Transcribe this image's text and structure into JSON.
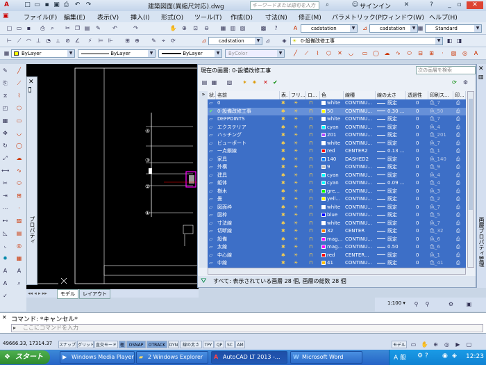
{
  "title_bar": {
    "title": "建築図面(異縮尺対応).dwg",
    "search_placeholder": "キーワードまたは語句を入力",
    "signin": "サインイン"
  },
  "menu": [
    "ファイル(F)",
    "編集(E)",
    "表示(V)",
    "挿入(I)",
    "形式(O)",
    "ツール(T)",
    "作成(D)",
    "寸法(N)",
    "修正(M)",
    "パラメトリック(P)",
    "ウィンドウ(W)",
    "ヘルプ(H)"
  ],
  "toolbars": {
    "annot_scale_1": "cadstation",
    "annot_scale_2": "cadstation",
    "annot_scale_3": "cadstation",
    "text_style": "Standard",
    "layer_combo": "0-設備改修工事",
    "props": {
      "color": "ByLayer",
      "linetype": "ByLayer",
      "lineweight": "ByLayer",
      "plotstyle": "ByColor"
    }
  },
  "layer_palette": {
    "current_layer": "現在の画層: 0-設備改修工事",
    "search_placeholder": "次の画層を検索",
    "columns": [
      "状.",
      "名前",
      "表.",
      "フリ...",
      "ロ...",
      "色",
      "線種",
      "線の太さ",
      "透過性",
      "印刷ス...",
      "印..."
    ],
    "rows": [
      {
        "name": "0",
        "color_name": "white",
        "color_hex": "#ffffff",
        "linetype": "CONTINU...",
        "lineweight": "既定",
        "transparency": "0",
        "plotstyle": "色_7",
        "current": false
      },
      {
        "name": "0-設備改修工事",
        "color_name": "50",
        "color_hex": "#ffff00",
        "linetype": "CONTINU...",
        "lineweight": "0.30 ...",
        "transparency": "0",
        "plotstyle": "色_50",
        "current": true
      },
      {
        "name": "DEFPOINTS",
        "color_name": "white",
        "color_hex": "#ffffff",
        "linetype": "CONTINU...",
        "lineweight": "既定",
        "transparency": "0",
        "plotstyle": "色_7",
        "current": false
      },
      {
        "name": "エクステリア",
        "color_name": "cyan",
        "color_hex": "#00ffff",
        "linetype": "CONTINU...",
        "lineweight": "既定",
        "transparency": "0",
        "plotstyle": "色_4",
        "current": false
      },
      {
        "name": "ハッチング",
        "color_name": "201",
        "color_hex": "#b24dff",
        "linetype": "CONTINU...",
        "lineweight": "既定",
        "transparency": "0",
        "plotstyle": "色_201",
        "current": false
      },
      {
        "name": "ビューポート",
        "color_name": "white",
        "color_hex": "#ffffff",
        "linetype": "CONTINU...",
        "lineweight": "既定",
        "transparency": "0",
        "plotstyle": "色_7",
        "current": false
      },
      {
        "name": "一点鎖線",
        "color_name": "red",
        "color_hex": "#ff0000",
        "linetype": "CENTER2",
        "lineweight": "0.13 ...",
        "transparency": "0",
        "plotstyle": "色_1",
        "current": false
      },
      {
        "name": "家具",
        "color_name": "140",
        "color_hex": "#007fff",
        "linetype": "DASHED2",
        "lineweight": "既定",
        "transparency": "0",
        "plotstyle": "色_140",
        "current": false
      },
      {
        "name": "外構",
        "color_name": "9",
        "color_hex": "#c0c0c0",
        "linetype": "CONTINU...",
        "lineweight": "既定",
        "transparency": "0",
        "plotstyle": "色_9",
        "current": false
      },
      {
        "name": "建具",
        "color_name": "cyan",
        "color_hex": "#00ffff",
        "linetype": "CONTINU...",
        "lineweight": "既定",
        "transparency": "0",
        "plotstyle": "色_4",
        "current": false
      },
      {
        "name": "躯体",
        "color_name": "cyan",
        "color_hex": "#00ffff",
        "linetype": "CONTINU...",
        "lineweight": "0.09 ...",
        "transparency": "0",
        "plotstyle": "色_4",
        "current": false
      },
      {
        "name": "樹木",
        "color_name": "gre...",
        "color_hex": "#00ff00",
        "linetype": "CONTINU...",
        "lineweight": "既定",
        "transparency": "0",
        "plotstyle": "色_3",
        "current": false
      },
      {
        "name": "畳",
        "color_name": "yell...",
        "color_hex": "#ffff00",
        "linetype": "CONTINU...",
        "lineweight": "既定",
        "transparency": "0",
        "plotstyle": "色_2",
        "current": false
      },
      {
        "name": "図面枠",
        "color_name": "white",
        "color_hex": "#ffffff",
        "linetype": "CONTINU...",
        "lineweight": "既定",
        "transparency": "0",
        "plotstyle": "色_7",
        "current": false
      },
      {
        "name": "図枠",
        "color_name": "blue",
        "color_hex": "#0000ff",
        "linetype": "CONTINU...",
        "lineweight": "既定",
        "transparency": "0",
        "plotstyle": "色_5",
        "current": false
      },
      {
        "name": "寸法線",
        "color_name": "white",
        "color_hex": "#ffffff",
        "linetype": "CONTINU...",
        "lineweight": "既定",
        "transparency": "0",
        "plotstyle": "色_7",
        "current": false
      },
      {
        "name": "切断線",
        "color_name": "32",
        "color_hex": "#ff7f00",
        "linetype": "CENTER",
        "lineweight": "既定",
        "transparency": "0",
        "plotstyle": "色_32",
        "current": false
      },
      {
        "name": "設備",
        "color_name": "mag...",
        "color_hex": "#ff00ff",
        "linetype": "CONTINU...",
        "lineweight": "既定",
        "transparency": "0",
        "plotstyle": "色_6",
        "current": false
      },
      {
        "name": "太線",
        "color_name": "mag...",
        "color_hex": "#ff00ff",
        "linetype": "CONTINU...",
        "lineweight": "0.50",
        "transparency": "0",
        "plotstyle": "色_6",
        "current": false
      },
      {
        "name": "中心線",
        "color_name": "red",
        "color_hex": "#ff0000",
        "linetype": "CENTER...",
        "lineweight": "既定",
        "transparency": "0",
        "plotstyle": "色_1",
        "current": false
      },
      {
        "name": "中線",
        "color_name": "41",
        "color_hex": "#ffbf00",
        "linetype": "CONTINU...",
        "lineweight": "既定",
        "transparency": "0",
        "plotstyle": "色_41",
        "current": false
      }
    ],
    "footer": "すべて: 表示されている画層 28 個, 画層の総数 28 個",
    "side_title": "画層プロパティ管理",
    "props_title": "プロパティ"
  },
  "drawing": {
    "marks": [
      "④",
      "③",
      "②",
      "①"
    ],
    "tabs": [
      "モデル",
      "レイアウト"
    ]
  },
  "command": {
    "history": "コマンド: *キャンセル*",
    "prompt": "ここにコマンドを入力"
  },
  "status": {
    "coords": "49666.33, 17314.37",
    "buttons": [
      "スナップ",
      "グリッド",
      "直交モード",
      "極",
      "OSNAP",
      "OTRACK",
      "DYN",
      "線の太さ",
      "TPY",
      "QP",
      "SC",
      "AM"
    ],
    "model": "モデル",
    "scale": "1:100"
  },
  "taskbar": {
    "start": "スタート",
    "items": [
      "Windows Media Player",
      "2 Windows Explorer",
      "AutoCAD LT 2013 -...",
      "Microsoft Word"
    ],
    "clock": "12:23"
  },
  "colors": {
    "selection": "#3d6fc7",
    "current_row": "#6690d8",
    "drawing_bg": "#000000",
    "taskbar": "#2563c6"
  }
}
